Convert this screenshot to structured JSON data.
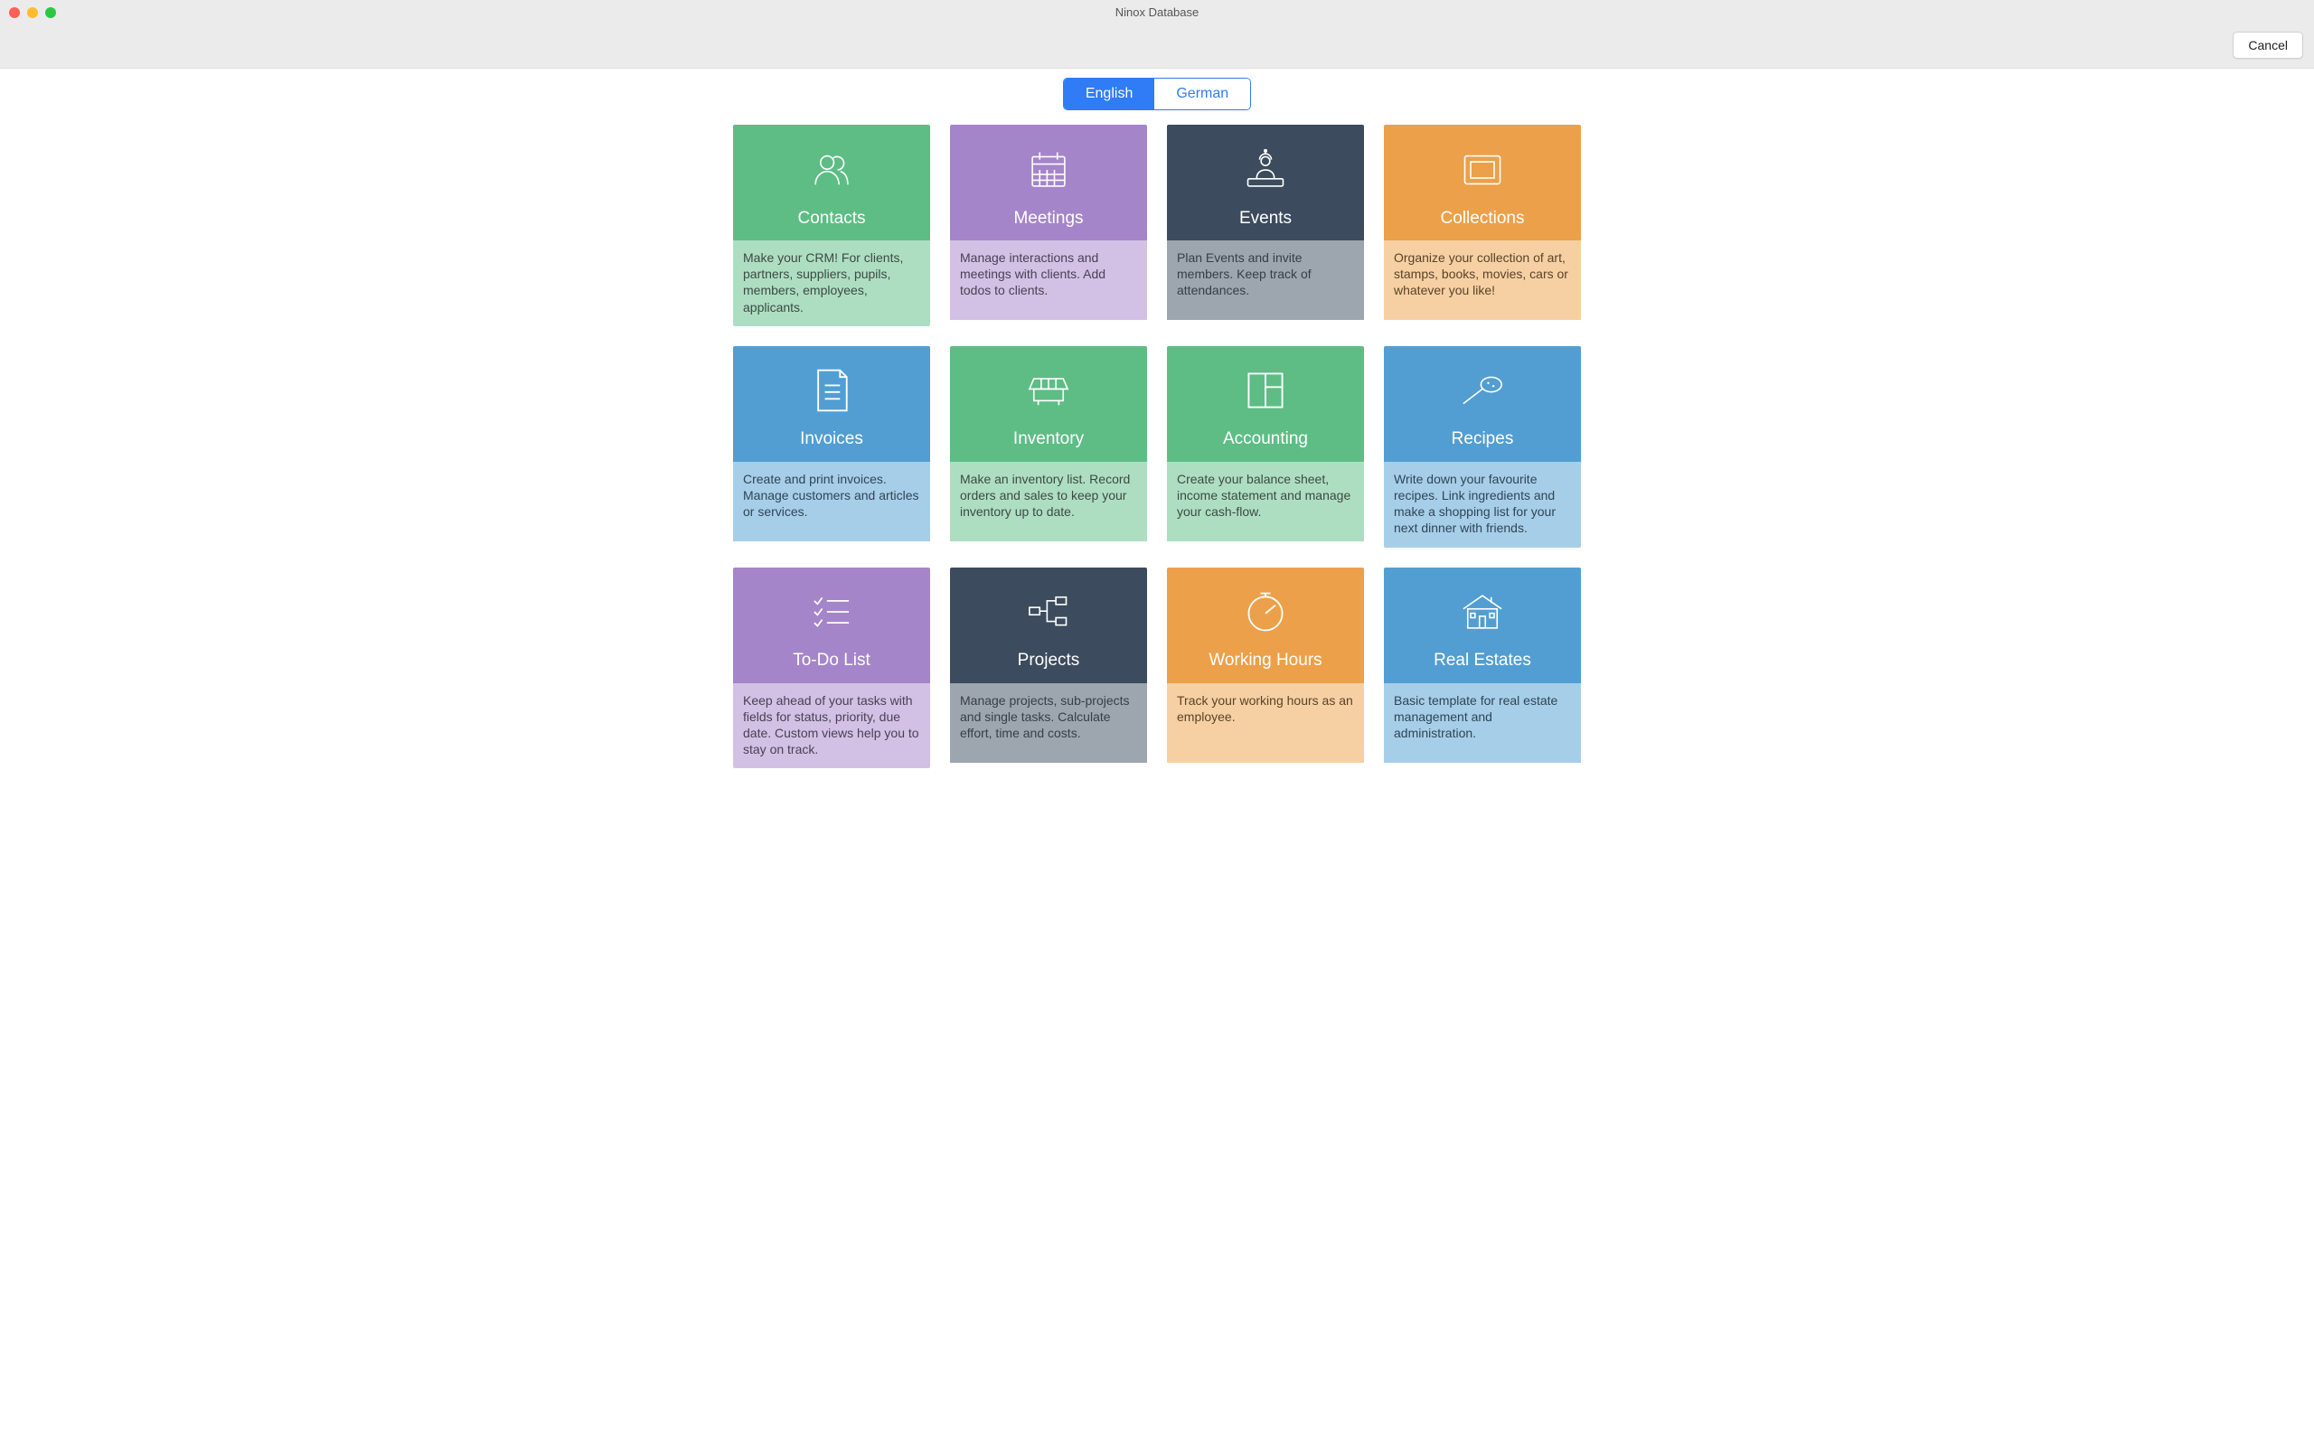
{
  "window": {
    "title": "Ninox Database",
    "cancel_label": "Cancel"
  },
  "language": {
    "options": [
      "English",
      "German"
    ],
    "active": "English"
  },
  "templates": [
    {
      "title": "Contacts",
      "description": "Make your CRM! For clients, partners, suppliers, pupils, members, employees, applicants.",
      "color": "green",
      "icon": "people-icon"
    },
    {
      "title": "Meetings",
      "description": "Manage interactions and meetings with clients. Add todos to clients.",
      "color": "purple",
      "icon": "calendar-icon"
    },
    {
      "title": "Events",
      "description": "Plan Events and invite members. Keep track of attendances.",
      "color": "navy",
      "icon": "dj-icon"
    },
    {
      "title": "Collections",
      "description": "Organize your collection of art, stamps, books, movies, cars or whatever you like!",
      "color": "orange",
      "icon": "frame-icon"
    },
    {
      "title": "Invoices",
      "description": "Create and print invoices. Manage customers and articles or services.",
      "color": "blue",
      "icon": "invoice-icon"
    },
    {
      "title": "Inventory",
      "description": "Make an inventory list. Record orders and sales to keep your inventory up to date.",
      "color": "green",
      "icon": "shelf-icon"
    },
    {
      "title": "Accounting",
      "description": "Create your balance sheet, income statement and manage your cash-flow.",
      "color": "green",
      "icon": "quadrant-icon"
    },
    {
      "title": "Recipes",
      "description": "Write down your favourite recipes. Link ingredients and make a shopping list for your next dinner with friends.",
      "color": "blue",
      "icon": "spoon-icon"
    },
    {
      "title": "To-Do List",
      "description": "Keep ahead of your tasks with fields for status, priority, due date. Custom views help you to stay on track.",
      "color": "purple",
      "icon": "checklist-icon"
    },
    {
      "title": "Projects",
      "description": "Manage projects, sub-projects and single tasks. Calculate effort, time and costs.",
      "color": "navy",
      "icon": "hierarchy-icon"
    },
    {
      "title": "Working Hours",
      "description": "Track your working hours as an employee.",
      "color": "orange",
      "icon": "stopwatch-icon"
    },
    {
      "title": "Real Estates",
      "description": "Basic template for real estate management and administration.",
      "color": "blue",
      "icon": "house-icon"
    }
  ]
}
